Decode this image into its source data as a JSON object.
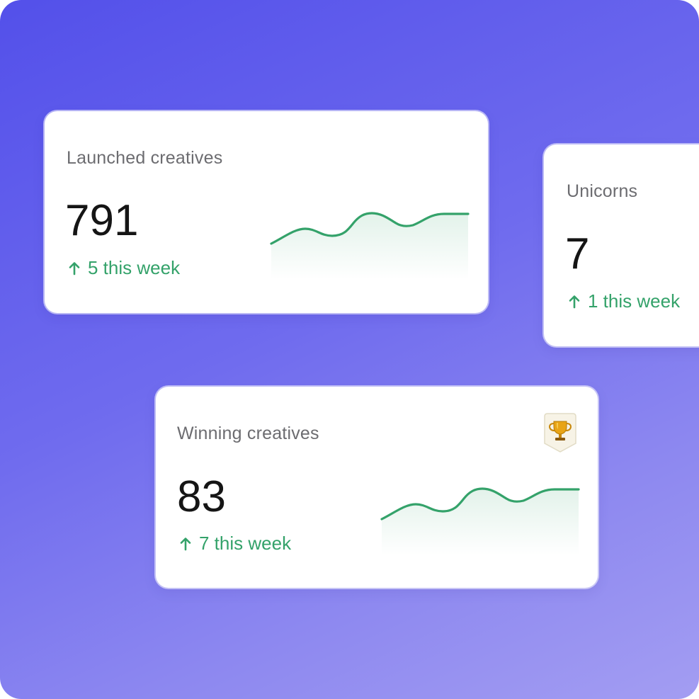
{
  "colors": {
    "accent_green": "#34a26a",
    "background_start": "#5350ea",
    "background_end": "#a39df2"
  },
  "cards": {
    "launched": {
      "title": "Launched creatives",
      "value": "791",
      "change": "5 this week",
      "change_icon": "arrow-up-icon",
      "trend_icon": "sparkline-icon"
    },
    "unicorns": {
      "title": "Unicorns",
      "value": "7",
      "change": "1 this week",
      "change_icon": "arrow-up-icon"
    },
    "winning": {
      "title": "Winning creatives",
      "value": "83",
      "change": "7 this week",
      "change_icon": "arrow-up-icon",
      "badge_icon": "trophy-icon",
      "trend_icon": "sparkline-icon"
    }
  }
}
